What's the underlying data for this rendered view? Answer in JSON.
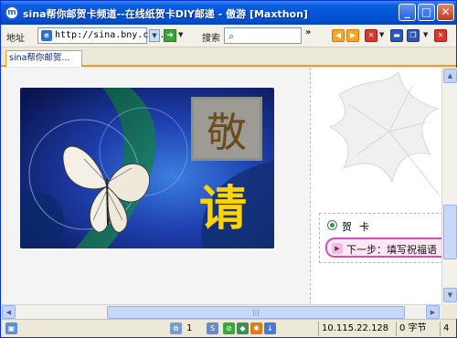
{
  "window": {
    "title": "sina帮你邮贺卡频道--在线纸贺卡DIY邮递 - 傲游 [Maxthon]",
    "app_icon": "m",
    "minimize_glyph": "_",
    "maximize_glyph": "□",
    "close_glyph": "✕"
  },
  "toolbar": {
    "address_label": "地址",
    "address_value": "http://sina.bny.com.",
    "search_label": "搜索",
    "go_glyph": "➜",
    "more_glyph": "»"
  },
  "tabs": [
    {
      "label": "sina帮你邮贺..."
    }
  ],
  "card": {
    "char_top": "敬",
    "char_main": "请"
  },
  "right_panel": {
    "radio_label": "贺卡",
    "next_button": "下一步：填写祝福语"
  },
  "statusbar": {
    "tab_count": "1",
    "ip": "10.115.22.128",
    "bytes": "0 字节",
    "last": "4"
  },
  "colors": {
    "title_blue": "#0555d8",
    "tab_accent": "#f39a21",
    "next_border": "#d34fb5",
    "card_gold": "#ffd400"
  },
  "icons": [
    "app-icon",
    "ie-page-icon",
    "go-arrow-icon",
    "search-magnifier-icon",
    "back-icon",
    "forward-icon",
    "stop-icon",
    "window-icon",
    "close-tab-icon",
    "radio-selected-icon",
    "next-arrow-icon"
  ]
}
